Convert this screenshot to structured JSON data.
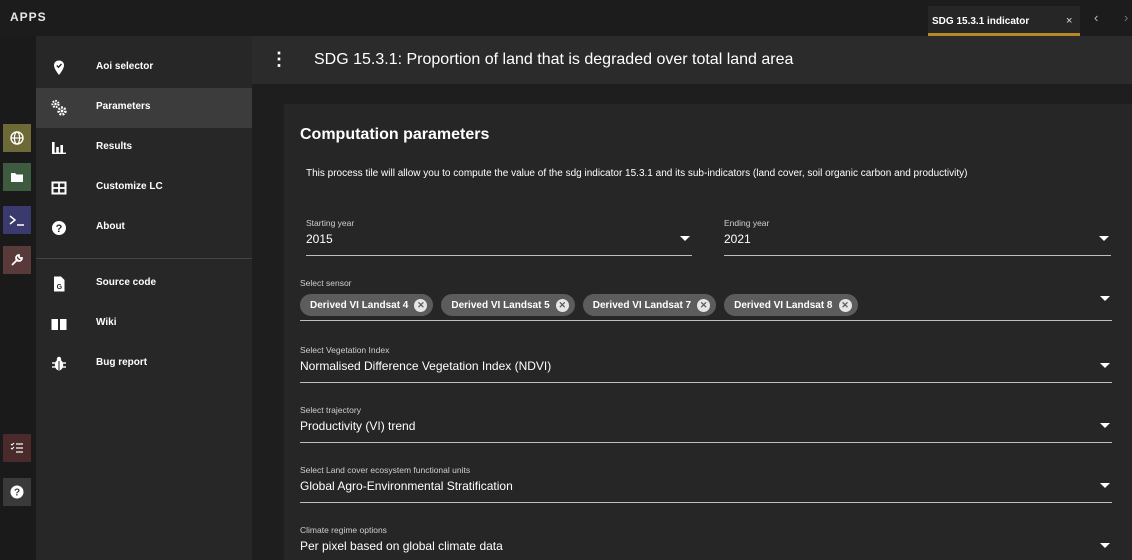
{
  "topbar": {
    "apps_title": "APPS",
    "tab_label": "SDG 15.3.1 indicator",
    "tab_close": "×",
    "prev": "‹",
    "next": "›"
  },
  "rail": {
    "icons": [
      "globe-icon",
      "folder-icon",
      "terminal-icon",
      "wrench-icon",
      "checklist-icon",
      "help-icon"
    ]
  },
  "drawer": {
    "items": [
      {
        "label": "Aoi selector",
        "icon": "map-marker-icon"
      },
      {
        "label": "Parameters",
        "icon": "cogs-icon"
      },
      {
        "label": "Results",
        "icon": "bar-chart-icon"
      },
      {
        "label": "Customize LC",
        "icon": "table-icon"
      },
      {
        "label": "About",
        "icon": "question-circle-icon"
      },
      {
        "label": "Source code",
        "icon": "file-code-icon"
      },
      {
        "label": "Wiki",
        "icon": "book-icon"
      },
      {
        "label": "Bug report",
        "icon": "bug-icon"
      }
    ],
    "active_index": 1
  },
  "header": {
    "title": "SDG 15.3.1: Proportion of land that is degraded over total land area"
  },
  "card": {
    "title": "Computation parameters",
    "description": "This process tile will allow you to compute the value of the sdg indicator 15.3.1 and its sub-indicators (land cover, soil organic carbon and productivity)",
    "start_year": {
      "label": "Starting year",
      "value": "2015"
    },
    "end_year": {
      "label": "Ending year",
      "value": "2021"
    },
    "sensor": {
      "label": "Select sensor",
      "chips": [
        "Derived VI Landsat 4",
        "Derived VI Landsat 5",
        "Derived VI Landsat 7",
        "Derived VI Landsat 8"
      ]
    },
    "vegetation_index": {
      "label": "Select Vegetation Index",
      "value": "Normalised Difference Vegetation Index (NDVI)"
    },
    "trajectory": {
      "label": "Select trajectory",
      "value": "Productivity (VI) trend"
    },
    "lc_units": {
      "label": "Select Land cover ecosystem functional units",
      "value": "Global Agro-Environmental Stratification"
    },
    "climate": {
      "label": "Climate regime options",
      "value": "Per pixel based on global climate data"
    }
  },
  "colors": {
    "tab_underline": "#b8862b",
    "active_nav": "#3c3c3c",
    "chip_bg": "#5c5c5c"
  }
}
